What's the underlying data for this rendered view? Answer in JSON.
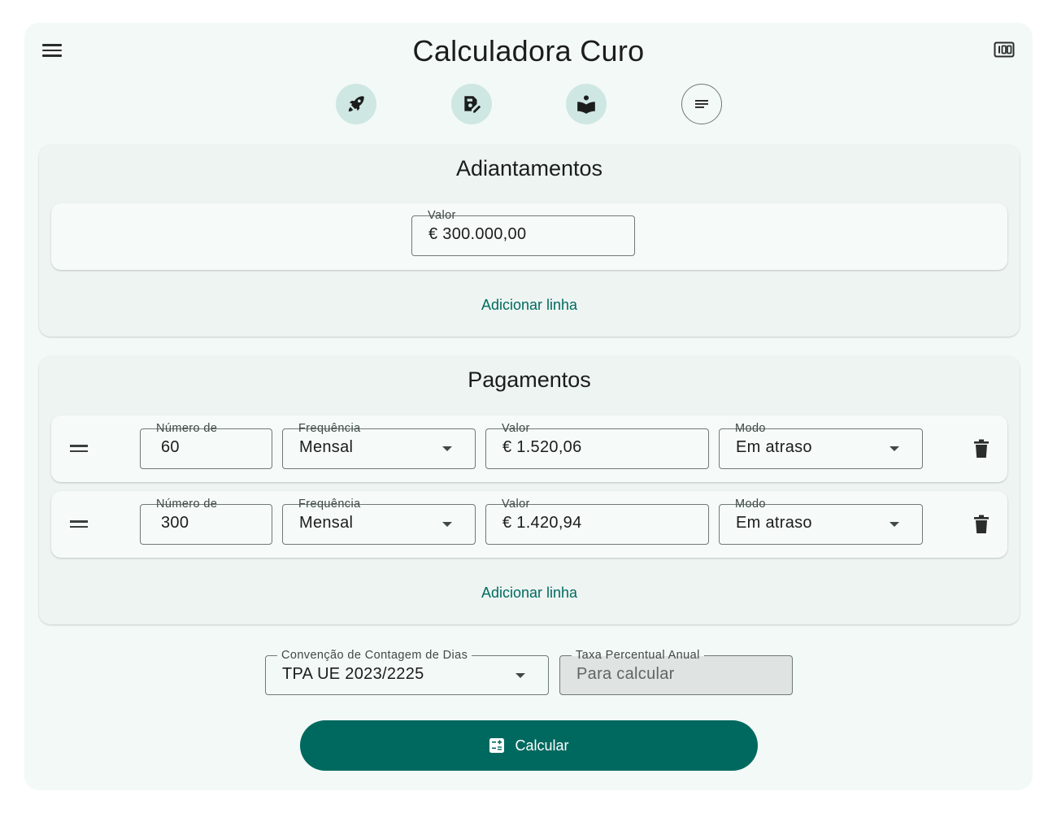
{
  "header": {
    "title": "Calculadora Curo",
    "menu_icon": "menu-icon",
    "counter_icon": "counter-icon"
  },
  "toolbar": {
    "buttons": [
      {
        "icon": "rocket-icon"
      },
      {
        "icon": "edit-document-icon"
      },
      {
        "icon": "reading-book-icon"
      },
      {
        "icon": "notes-icon"
      }
    ]
  },
  "advances": {
    "title": "Adiantamentos",
    "rows": [
      {
        "value_label": "Valor",
        "value": "€ 300.000,00"
      }
    ],
    "add_line": "Adicionar linha"
  },
  "payments": {
    "title": "Pagamentos",
    "rows": [
      {
        "count_label": "Número de",
        "count": "60",
        "frequency_label": "Frequência",
        "frequency": "Mensal",
        "value_label": "Valor",
        "value": "€ 1.520,06",
        "mode_label": "Modo",
        "mode": "Em atraso"
      },
      {
        "count_label": "Número de",
        "count": "300",
        "frequency_label": "Frequência",
        "frequency": "Mensal",
        "value_label": "Valor",
        "value": "€ 1.420,94",
        "mode_label": "Modo",
        "mode": "Em atraso"
      }
    ],
    "add_line": "Adicionar linha"
  },
  "settings": {
    "day_count_label": "Convenção de Contagem de Dias",
    "day_count_value": "TPA UE 2023/2225",
    "apr_label": "Taxa Percentual Anual",
    "apr_value": "Para calcular"
  },
  "calculate": {
    "label": "Calcular",
    "icon": "calculator-icon"
  },
  "colors": {
    "primary": "#00695f",
    "tonal": "#cfe7e2",
    "surface": "#f3f9f7"
  }
}
